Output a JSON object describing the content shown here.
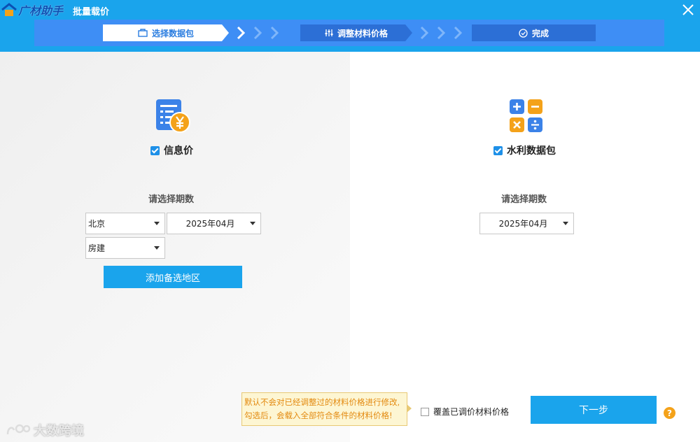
{
  "app": {
    "brand": "广材助手",
    "window_title": "批量载价"
  },
  "steps": [
    {
      "label": "选择数据包"
    },
    {
      "label": "调整材料价格"
    },
    {
      "label": "完成"
    }
  ],
  "left": {
    "checkbox_label": "信息价",
    "period_label": "请选择期数",
    "region": "北京",
    "period": "2025年04月",
    "category": "房建",
    "add_button": "添加备选地区"
  },
  "right": {
    "checkbox_label": "水利数据包",
    "period_label": "请选择期数",
    "period": "2025年04月"
  },
  "footer": {
    "tooltip_line1": "默认不会对已经调整过的材料价格进行修改,",
    "tooltip_line2": "勾选后，会载入全部符合条件的材料价格!",
    "overwrite_label": "覆盖已调价材料价格",
    "next_button": "下一步",
    "help": "?"
  },
  "watermark": "大数跨境",
  "colors": {
    "header": "#1aa4ec",
    "steps_bar": "#3e8ef5",
    "accent_orange": "#f4a21a"
  }
}
